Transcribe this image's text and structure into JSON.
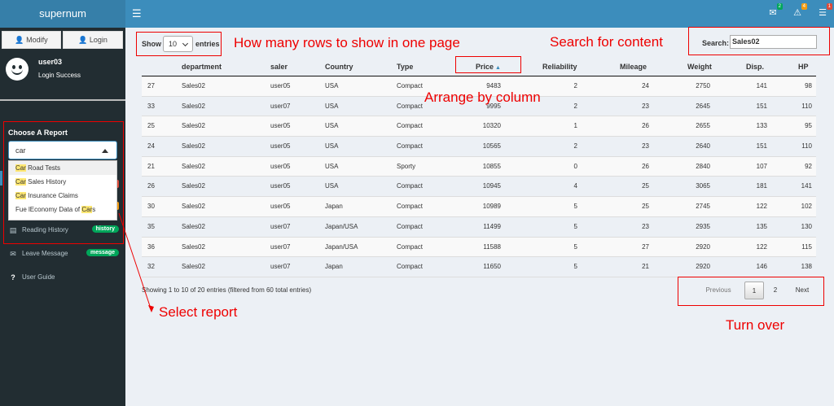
{
  "app": {
    "title": "supernum"
  },
  "topbar": {
    "menu_icon": "hamburger-icon",
    "icons": [
      {
        "name": "envelope-icon",
        "glyph": "✉",
        "badge": "2",
        "badge_color": "#00a65a"
      },
      {
        "name": "warning-icon",
        "glyph": "⚠",
        "badge": "4",
        "badge_color": "#f39c12"
      },
      {
        "name": "tasks-icon",
        "glyph": "☰",
        "badge": "1",
        "badge_color": "#dd4b39"
      }
    ]
  },
  "sidebar": {
    "modify_label": "Modify",
    "login_label": "Login",
    "user": {
      "name": "user03",
      "status": "Login Success"
    },
    "report_label": "Choose A Report",
    "select_value": "car",
    "options": [
      {
        "hl": "Car",
        "pre": "",
        "post": " Road Tests"
      },
      {
        "hl": "Car",
        "pre": "",
        "post": " Sales History"
      },
      {
        "hl": "Car",
        "pre": "",
        "post": " Insurance Claims"
      },
      {
        "hl": "Car",
        "pre": "Fue lEconomy Data of ",
        "post": "s"
      }
    ],
    "menu": [
      {
        "label": "Reading History",
        "badge": "history",
        "icon": "book-icon",
        "glyph": "▤"
      },
      {
        "label": "Leave Message",
        "badge": "message",
        "icon": "envelope-icon",
        "glyph": "✉"
      },
      {
        "label": "User Guide",
        "badge": "",
        "icon": "question-icon",
        "glyph": "?"
      }
    ]
  },
  "table_controls": {
    "show_label": "Show",
    "page_size": "10",
    "entries_label": "entries",
    "search_label": "Search:",
    "search_value": "Sales02"
  },
  "table": {
    "columns": [
      "",
      "department",
      "saler",
      "Country",
      "Type",
      "Price",
      "Reliability",
      "Mileage",
      "Weight",
      "Disp.",
      "HP"
    ],
    "sorted_column": "Price",
    "rows": [
      [
        "27",
        "Sales02",
        "user05",
        "USA",
        "Compact",
        "9483",
        "2",
        "24",
        "2750",
        "141",
        "98"
      ],
      [
        "33",
        "Sales02",
        "user07",
        "USA",
        "Compact",
        "9995",
        "2",
        "23",
        "2645",
        "151",
        "110"
      ],
      [
        "25",
        "Sales02",
        "user05",
        "USA",
        "Compact",
        "10320",
        "1",
        "26",
        "2655",
        "133",
        "95"
      ],
      [
        "24",
        "Sales02",
        "user05",
        "USA",
        "Compact",
        "10565",
        "2",
        "23",
        "2640",
        "151",
        "110"
      ],
      [
        "21",
        "Sales02",
        "user05",
        "USA",
        "Sporty",
        "10855",
        "0",
        "26",
        "2840",
        "107",
        "92"
      ],
      [
        "26",
        "Sales02",
        "user05",
        "USA",
        "Compact",
        "10945",
        "4",
        "25",
        "3065",
        "181",
        "141"
      ],
      [
        "30",
        "Sales02",
        "user05",
        "Japan",
        "Compact",
        "10989",
        "5",
        "25",
        "2745",
        "122",
        "102"
      ],
      [
        "35",
        "Sales02",
        "user07",
        "Japan/USA",
        "Compact",
        "11499",
        "5",
        "23",
        "2935",
        "135",
        "130"
      ],
      [
        "36",
        "Sales02",
        "user07",
        "Japan/USA",
        "Compact",
        "11588",
        "5",
        "27",
        "2920",
        "122",
        "115"
      ],
      [
        "32",
        "Sales02",
        "user07",
        "Japan",
        "Compact",
        "11650",
        "5",
        "21",
        "2920",
        "146",
        "138"
      ]
    ]
  },
  "info_text": "Showing 1 to 10 of 20 entries (filtered from 60 total entries)",
  "pagination": {
    "previous": "Previous",
    "pages": [
      "1",
      "2"
    ],
    "current": "1",
    "next": "Next"
  },
  "annotations": {
    "rows_note": "How many rows to show in one page",
    "search_note": "Search for content",
    "sort_note": "Arrange by column",
    "select_note": "Select report",
    "pager_note": "Turn over",
    "color": "#ee0000"
  }
}
